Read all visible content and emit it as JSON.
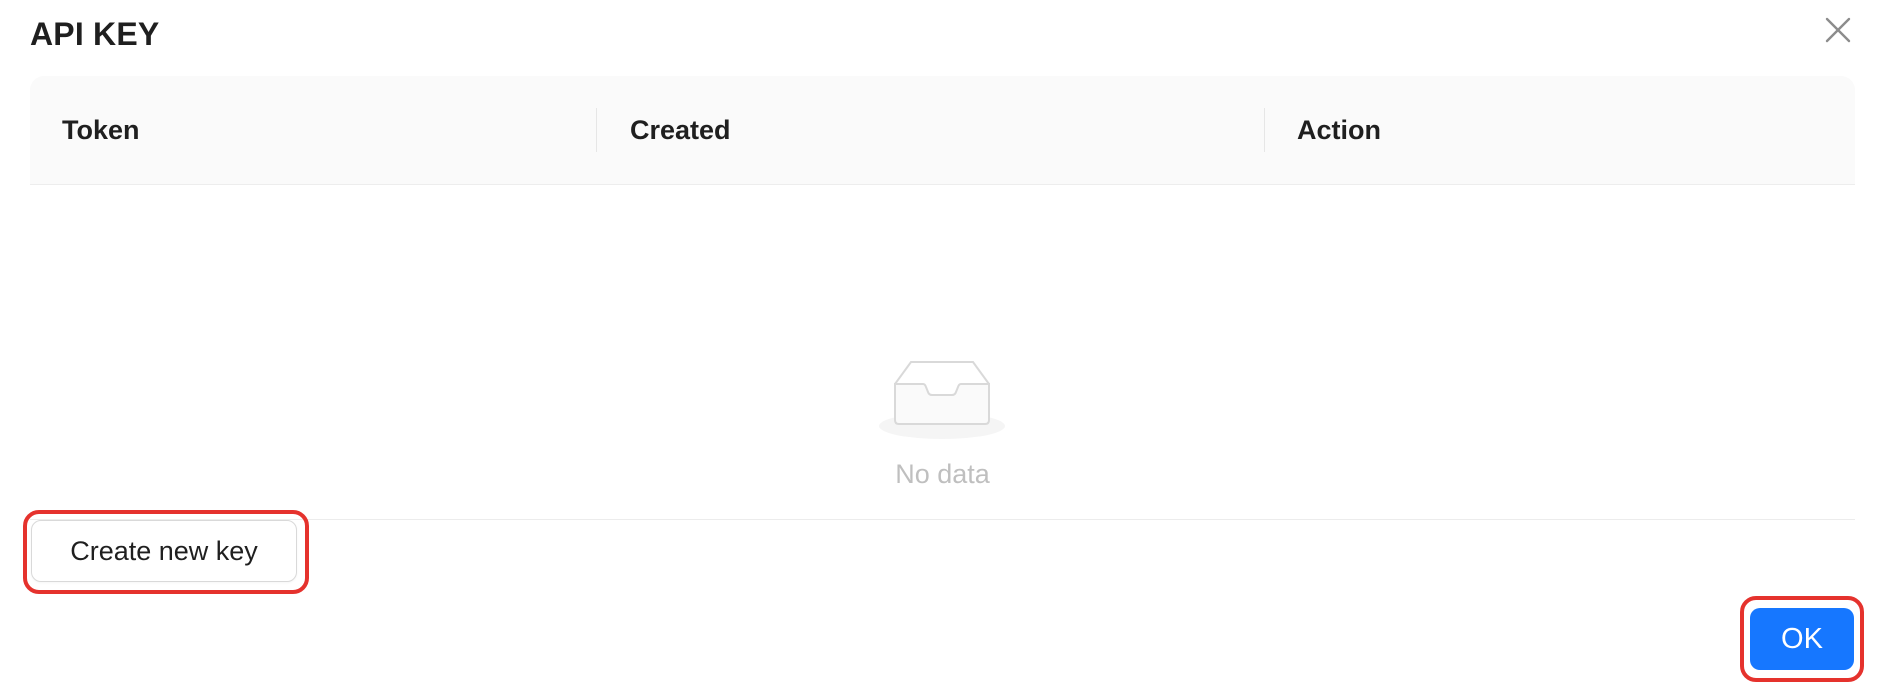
{
  "modal": {
    "title": "API KEY",
    "close_icon": "close-icon"
  },
  "table": {
    "columns": [
      "Token",
      "Created",
      "Action"
    ],
    "rows": [],
    "empty": {
      "icon": "empty-inbox-icon",
      "text": "No data"
    }
  },
  "footer": {
    "create_label": "Create new key",
    "ok_label": "OK"
  },
  "colors": {
    "primary": "#1677ff",
    "highlight": "#e5322d",
    "muted_text": "#bfbfbf",
    "header_bg": "#fafafa"
  }
}
